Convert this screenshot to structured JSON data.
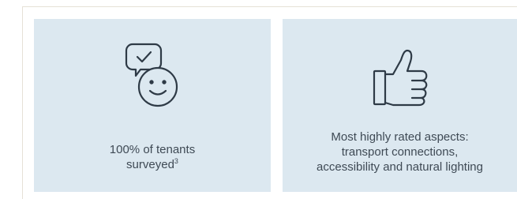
{
  "cards": [
    {
      "icon": "satisfaction-smiley-icon",
      "lines": [
        "100% of tenants",
        "surveyed"
      ],
      "footnote": "3"
    },
    {
      "icon": "thumbs-up-icon",
      "lines": [
        "Most highly rated aspects:",
        "transport connections,",
        "accessibility and natural lighting"
      ]
    }
  ],
  "colors": {
    "card_background": "#dce8f0",
    "icon_stroke": "#2e3a46",
    "text": "#3f4a55",
    "frame_border": "#e6e1d7"
  }
}
